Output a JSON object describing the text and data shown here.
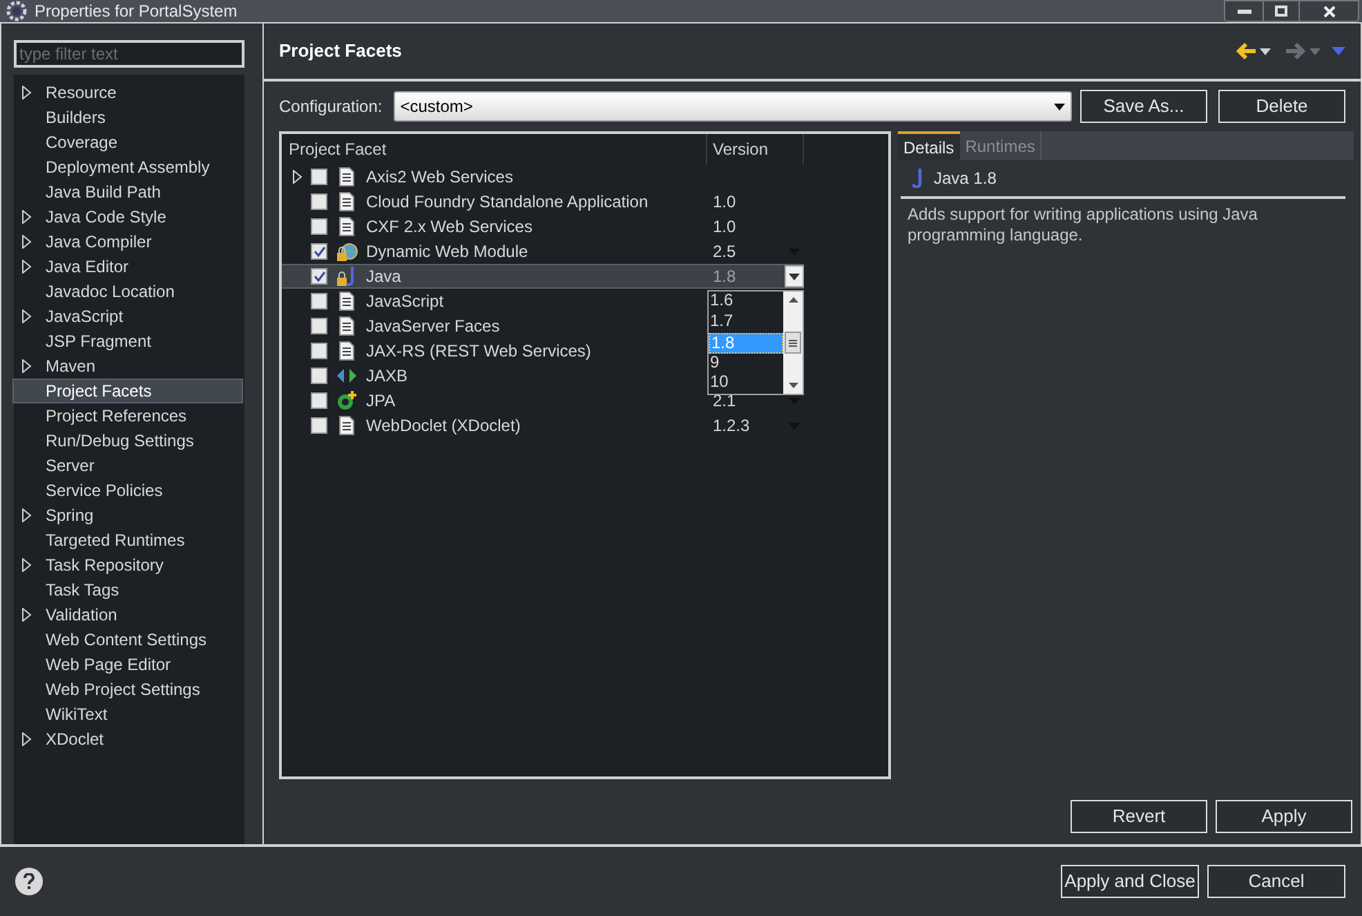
{
  "window": {
    "title": "Properties for PortalSystem"
  },
  "filter": {
    "placeholder": "type filter text"
  },
  "sidebar": {
    "items": [
      {
        "label": "Resource",
        "expandable": true,
        "selected": false
      },
      {
        "label": "Builders",
        "expandable": false,
        "selected": false
      },
      {
        "label": "Coverage",
        "expandable": false,
        "selected": false
      },
      {
        "label": "Deployment Assembly",
        "expandable": false,
        "selected": false
      },
      {
        "label": "Java Build Path",
        "expandable": false,
        "selected": false
      },
      {
        "label": "Java Code Style",
        "expandable": true,
        "selected": false
      },
      {
        "label": "Java Compiler",
        "expandable": true,
        "selected": false
      },
      {
        "label": "Java Editor",
        "expandable": true,
        "selected": false
      },
      {
        "label": "Javadoc Location",
        "expandable": false,
        "selected": false
      },
      {
        "label": "JavaScript",
        "expandable": true,
        "selected": false
      },
      {
        "label": "JSP Fragment",
        "expandable": false,
        "selected": false
      },
      {
        "label": "Maven",
        "expandable": true,
        "selected": false
      },
      {
        "label": "Project Facets",
        "expandable": false,
        "selected": true
      },
      {
        "label": "Project References",
        "expandable": false,
        "selected": false
      },
      {
        "label": "Run/Debug Settings",
        "expandable": false,
        "selected": false
      },
      {
        "label": "Server",
        "expandable": false,
        "selected": false
      },
      {
        "label": "Service Policies",
        "expandable": false,
        "selected": false
      },
      {
        "label": "Spring",
        "expandable": true,
        "selected": false
      },
      {
        "label": "Targeted Runtimes",
        "expandable": false,
        "selected": false
      },
      {
        "label": "Task Repository",
        "expandable": true,
        "selected": false
      },
      {
        "label": "Task Tags",
        "expandable": false,
        "selected": false
      },
      {
        "label": "Validation",
        "expandable": true,
        "selected": false
      },
      {
        "label": "Web Content Settings",
        "expandable": false,
        "selected": false
      },
      {
        "label": "Web Page Editor",
        "expandable": false,
        "selected": false
      },
      {
        "label": "Web Project Settings",
        "expandable": false,
        "selected": false
      },
      {
        "label": "WikiText",
        "expandable": false,
        "selected": false
      },
      {
        "label": "XDoclet",
        "expandable": true,
        "selected": false
      }
    ]
  },
  "page": {
    "title": "Project Facets"
  },
  "configuration": {
    "label": "Configuration:",
    "value": "<custom>",
    "buttons": [
      "Save As...",
      "Delete"
    ]
  },
  "table": {
    "columns": [
      "Project Facet",
      "Version"
    ],
    "rows": [
      {
        "kind": "document",
        "name": "Axis2 Web Services",
        "expandable": true,
        "checked": false,
        "version": "",
        "has_dropdown": false,
        "selected": false
      },
      {
        "kind": "document",
        "name": "Cloud Foundry Standalone Application",
        "expandable": false,
        "checked": false,
        "version": "1.0",
        "has_dropdown": false,
        "selected": false
      },
      {
        "kind": "document",
        "name": "CXF 2.x Web Services",
        "expandable": false,
        "checked": false,
        "version": "1.0",
        "has_dropdown": false,
        "selected": false
      },
      {
        "kind": "web-module",
        "name": "Dynamic Web Module",
        "expandable": false,
        "checked": true,
        "version": "2.5",
        "has_dropdown": true,
        "selected": false
      },
      {
        "kind": "java",
        "name": "Java",
        "expandable": false,
        "checked": true,
        "version": "1.8",
        "has_dropdown": true,
        "selected": true
      },
      {
        "kind": "document",
        "name": "JavaScript",
        "expandable": false,
        "checked": false,
        "version": "",
        "has_dropdown": false,
        "selected": false
      },
      {
        "kind": "document",
        "name": "JavaServer Faces",
        "expandable": false,
        "checked": false,
        "version": "",
        "has_dropdown": false,
        "selected": false
      },
      {
        "kind": "document",
        "name": "JAX-RS (REST Web Services)",
        "expandable": false,
        "checked": false,
        "version": "",
        "has_dropdown": false,
        "selected": false
      },
      {
        "kind": "jaxb",
        "name": "JAXB",
        "expandable": false,
        "checked": false,
        "version": "",
        "has_dropdown": false,
        "selected": false
      },
      {
        "kind": "jpa",
        "name": "JPA",
        "expandable": false,
        "checked": false,
        "version": "2.1",
        "has_dropdown": true,
        "selected": false
      },
      {
        "kind": "document",
        "name": "WebDoclet (XDoclet)",
        "expandable": false,
        "checked": false,
        "version": "1.2.3",
        "has_dropdown": true,
        "selected": false
      }
    ]
  },
  "version_list": {
    "options": [
      {
        "label": "1.6",
        "selected": false
      },
      {
        "label": "1.7",
        "selected": false
      },
      {
        "label": "1.8",
        "selected": true
      },
      {
        "label": "9",
        "selected": false
      },
      {
        "label": "10",
        "selected": false
      }
    ]
  },
  "details": {
    "tabs": [
      {
        "label": "Details",
        "selected": true
      },
      {
        "label": "Runtimes",
        "selected": false
      }
    ],
    "title": "Java 1.8",
    "description": "Adds support for writing applications using Java programming language."
  },
  "page_buttons": [
    "Revert",
    "Apply"
  ],
  "dialog_buttons": [
    "Apply and Close",
    "Cancel"
  ]
}
